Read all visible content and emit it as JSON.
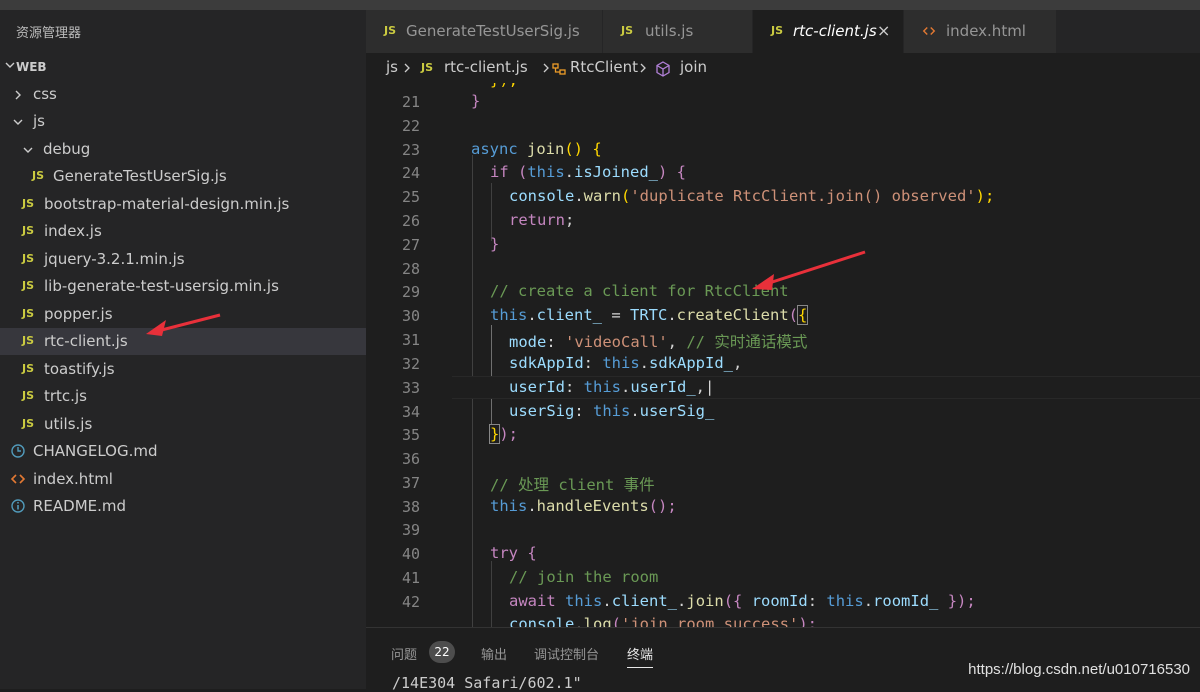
{
  "explorer": {
    "title": "资源管理器",
    "root": "WEB",
    "items": [
      {
        "label": "css",
        "type": "folder",
        "open": false
      },
      {
        "label": "js",
        "type": "folder",
        "open": true
      },
      {
        "label": "debug",
        "type": "folder",
        "open": true
      },
      {
        "label": "GenerateTestUserSig.js",
        "type": "js"
      },
      {
        "label": "bootstrap-material-design.min.js",
        "type": "js"
      },
      {
        "label": "index.js",
        "type": "js"
      },
      {
        "label": "jquery-3.2.1.min.js",
        "type": "js"
      },
      {
        "label": "lib-generate-test-usersig.min.js",
        "type": "js"
      },
      {
        "label": "popper.js",
        "type": "js"
      },
      {
        "label": "rtc-client.js",
        "type": "js",
        "selected": true
      },
      {
        "label": "toastify.js",
        "type": "js"
      },
      {
        "label": "trtc.js",
        "type": "js"
      },
      {
        "label": "utils.js",
        "type": "js"
      },
      {
        "label": "CHANGELOG.md",
        "type": "md-changelog"
      },
      {
        "label": "index.html",
        "type": "html"
      },
      {
        "label": "README.md",
        "type": "md-readme"
      }
    ],
    "js_badge": "JS"
  },
  "tabs": [
    {
      "label": "GenerateTestUserSig.js",
      "icon": "js"
    },
    {
      "label": "utils.js",
      "icon": "js"
    },
    {
      "label": "rtc-client.js",
      "icon": "js",
      "active": true,
      "close": "×"
    },
    {
      "label": "index.html",
      "icon": "html"
    }
  ],
  "breadcrumb": {
    "folder": "js",
    "file": "rtc-client.js",
    "class_name": "RtcClient",
    "method": "join"
  },
  "editor": {
    "line_numbers": [
      "21",
      "22",
      "23",
      "24",
      "25",
      "26",
      "27",
      "28",
      "29",
      "30",
      "31",
      "32",
      "33",
      "34",
      "35",
      "36",
      "37",
      "38",
      "39",
      "40",
      "41",
      "42"
    ],
    "code": {
      "l20": "});",
      "l21": "}",
      "l23_async": "async",
      "l23_fn": "join",
      "l23_rest": "() {",
      "l24_if": "if",
      "l24_a": " (",
      "l24_this": "this",
      "l24_b": ".",
      "l24_prop": "isJoined_",
      "l24_c": ") {",
      "l25_obj": "console",
      "l25_dot": ".",
      "l25_fn": "warn",
      "l25_a": "(",
      "l25_str": "'duplicate RtcClient.join() observed'",
      "l25_b": ");",
      "l26_ret": "return",
      "l26_b": ";",
      "l27": "}",
      "l29": "// create a client for RtcClient",
      "l30_this": "this",
      "l30_a": ".",
      "l30_prop": "client_",
      "l30_b": " = ",
      "l30_obj": "TRTC",
      "l30_c": ".",
      "l30_fn": "createClient",
      "l30_d": "(",
      "l30_brace": "{",
      "l31_key": "mode",
      "l31_a": ": ",
      "l31_str": "'videoCall'",
      "l31_b": ", ",
      "l31_cmt": "// 实时通话模式",
      "l32_key": "sdkAppId",
      "l32_a": ": ",
      "l32_this": "this",
      "l32_b": ".",
      "l32_prop": "sdkAppId_",
      "l32_c": ",",
      "l33_key": "userId",
      "l33_a": ": ",
      "l33_this": "this",
      "l33_b": ".",
      "l33_prop": "userId_",
      "l33_c": ",|",
      "l34_key": "userSig",
      "l34_a": ": ",
      "l34_this": "this",
      "l34_b": ".",
      "l34_prop": "userSig_",
      "l35_brace": "}",
      "l35_rest": ");",
      "l37": "// 处理 client 事件",
      "l38_this": "this",
      "l38_a": ".",
      "l38_fn": "handleEvents",
      "l38_b": "();",
      "l40_try": "try",
      "l40_b": " {",
      "l41": "// join the room",
      "l42_await": "await",
      "l42_sp": " ",
      "l42_this": "this",
      "l42_a": ".",
      "l42_prop": "client_",
      "l42_b": ".",
      "l42_fn": "join",
      "l42_c": "({ ",
      "l42_key": "roomId",
      "l42_d": ": ",
      "l42_this2": "this",
      "l42_e": ".",
      "l42_prop2": "roomId_",
      "l42_f": " });",
      "l43_obj": "console",
      "l43_a": ".",
      "l43_fn": "log",
      "l43_b": "(",
      "l43_str": "'join room success'",
      "l43_c": ");"
    }
  },
  "panel": {
    "tabs": [
      "问题",
      "输出",
      "调试控制台",
      "终端"
    ],
    "active_tab": "终端",
    "problems_count": "22",
    "terminal_text": "/14E304 Safari/602.1\""
  },
  "watermark": "https://blog.csdn.net/u010716530",
  "colors": {
    "annotation_arrow": "#e8303a",
    "js_badge": "#cbcb41",
    "html_icon": "#e37933",
    "md_icon": "#519aba"
  }
}
